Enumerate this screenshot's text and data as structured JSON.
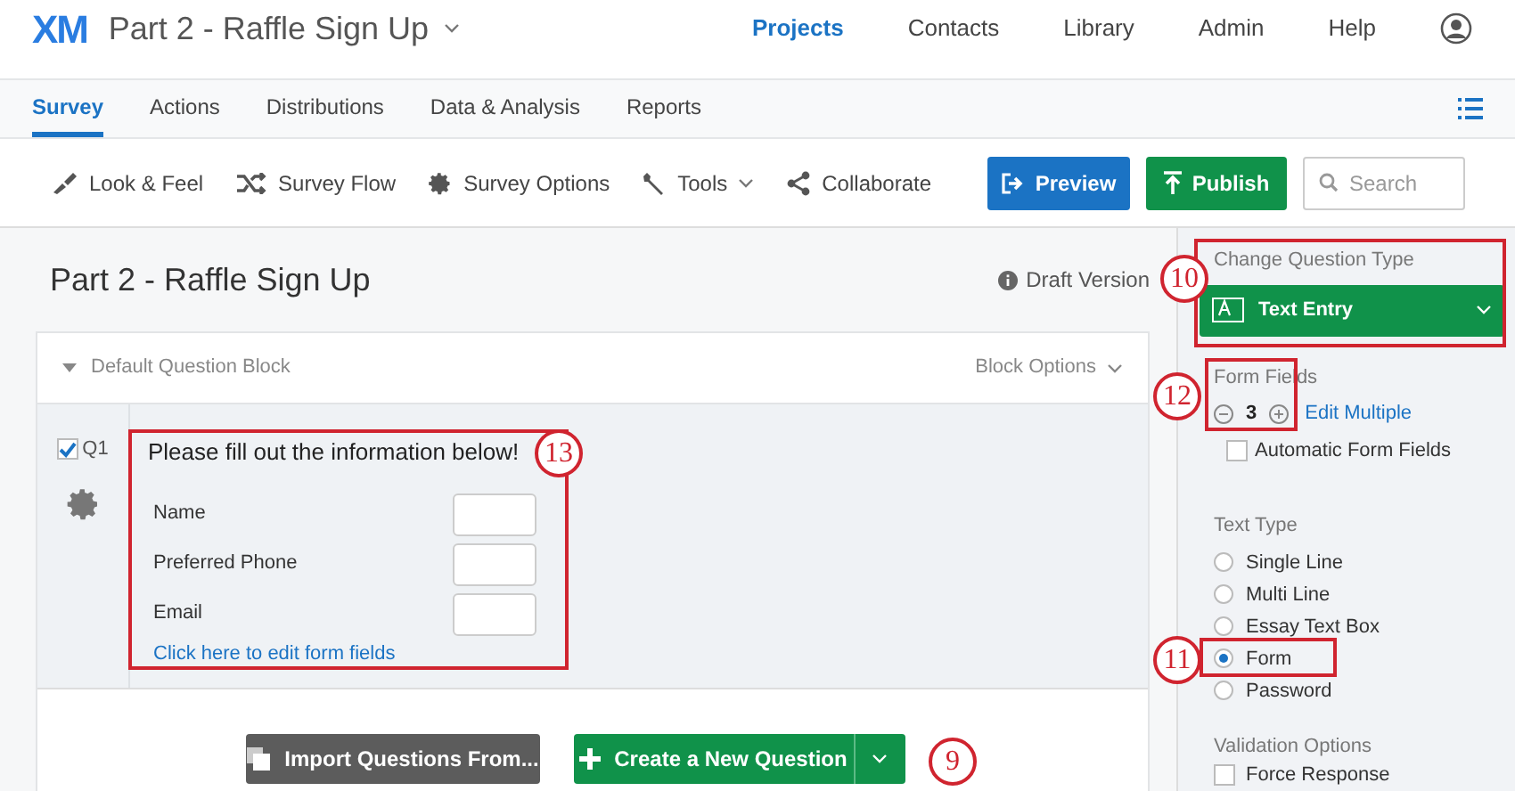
{
  "header": {
    "logo": "XM",
    "survey_title": "Part 2 - Raffle Sign Up",
    "nav": [
      {
        "label": "Projects",
        "selected": true
      },
      {
        "label": "Contacts",
        "selected": false
      },
      {
        "label": "Library",
        "selected": false
      },
      {
        "label": "Admin",
        "selected": false
      },
      {
        "label": "Help",
        "selected": false
      }
    ]
  },
  "tabs": [
    {
      "label": "Survey",
      "selected": true
    },
    {
      "label": "Actions",
      "selected": false
    },
    {
      "label": "Distributions",
      "selected": false
    },
    {
      "label": "Data & Analysis",
      "selected": false
    },
    {
      "label": "Reports",
      "selected": false
    }
  ],
  "toolbar": {
    "items": [
      {
        "label": "Look & Feel",
        "kind": "brush"
      },
      {
        "label": "Survey Flow",
        "kind": "flow"
      },
      {
        "label": "Survey Options",
        "kind": "gear"
      },
      {
        "label": "Tools",
        "kind": "wrench"
      },
      {
        "label": "Collaborate",
        "kind": "share"
      }
    ],
    "preview": "Preview",
    "publish": "Publish",
    "search": {
      "placeholder": "Search"
    }
  },
  "editor": {
    "title": "Part 2 - Raffle Sign Up",
    "status": "Draft Version",
    "block": {
      "name": "Default Question Block",
      "options": "Block Options",
      "question": {
        "id": "Q1",
        "checked": true,
        "text": "Please fill out the information below!",
        "fields": [
          "Name",
          "Preferred Phone",
          "Email"
        ],
        "edit_link": "Click here to edit form fields"
      }
    },
    "import_button": "Import Questions From...",
    "create_button": "Create a New Question"
  },
  "panel": {
    "change_type_label": "Change Question Type",
    "question_type": "Text Entry",
    "form_fields_label": "Form Fields",
    "form_fields_count": "3",
    "edit_multiple": "Edit Multiple",
    "automatic": {
      "label": "Automatic Form Fields",
      "checked": false
    },
    "text_type_label": "Text Type",
    "text_types": [
      {
        "label": "Single Line",
        "selected": false
      },
      {
        "label": "Multi Line",
        "selected": false
      },
      {
        "label": "Essay Text Box",
        "selected": false
      },
      {
        "label": "Form",
        "selected": true
      },
      {
        "label": "Password",
        "selected": false
      }
    ],
    "validation_label": "Validation Options",
    "force_response": {
      "label": "Force Response",
      "checked": false
    }
  },
  "callouts": [
    {
      "number": "10"
    },
    {
      "number": "12"
    },
    {
      "number": "13"
    },
    {
      "number": "11"
    },
    {
      "number": "9"
    }
  ]
}
